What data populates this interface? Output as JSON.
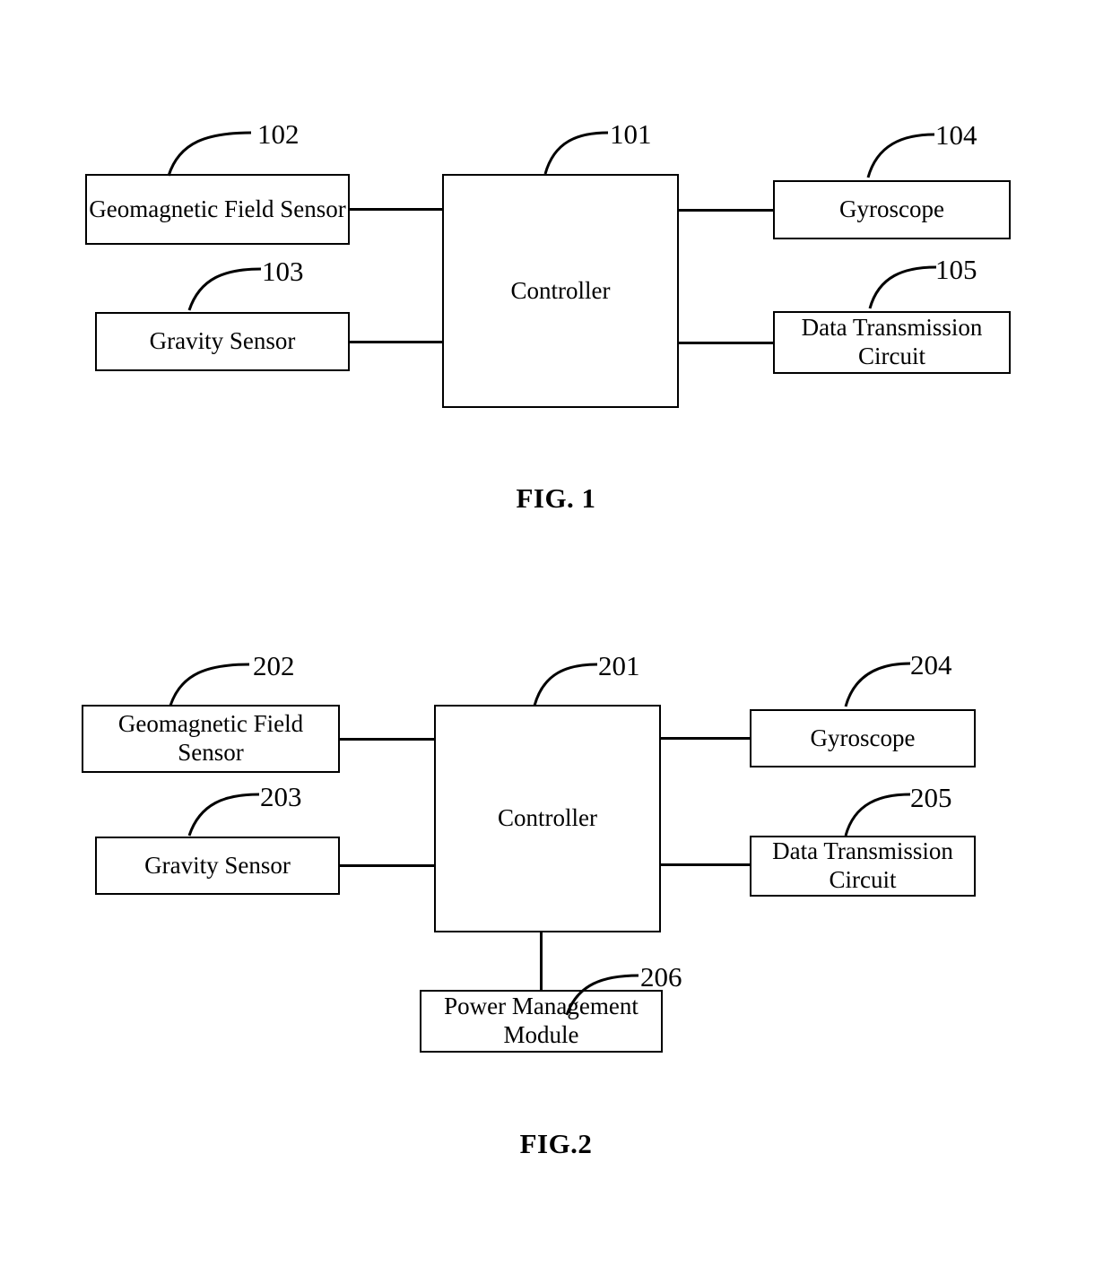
{
  "document": {
    "type": "patent-figure-sheet",
    "figures": [
      {
        "id": "fig1",
        "caption": "FIG. 1",
        "nodes": [
          {
            "key": "controller",
            "label": "Controller",
            "ref": "101"
          },
          {
            "key": "geomagnetic",
            "label": "Geomagnetic Field Sensor",
            "ref": "102"
          },
          {
            "key": "gravity",
            "label": "Gravity Sensor",
            "ref": "103"
          },
          {
            "key": "gyroscope",
            "label": "Gyroscope",
            "ref": "104"
          },
          {
            "key": "datatx",
            "label": "Data Transmission Circuit",
            "ref": "105"
          }
        ],
        "connections": [
          {
            "from": "geomagnetic",
            "to": "controller"
          },
          {
            "from": "gravity",
            "to": "controller"
          },
          {
            "from": "controller",
            "to": "gyroscope"
          },
          {
            "from": "controller",
            "to": "datatx"
          }
        ]
      },
      {
        "id": "fig2",
        "caption": "FIG.2",
        "nodes": [
          {
            "key": "controller",
            "label": "Controller",
            "ref": "201"
          },
          {
            "key": "geomagnetic",
            "label": "Geomagnetic Field Sensor",
            "ref": "202"
          },
          {
            "key": "gravity",
            "label": "Gravity Sensor",
            "ref": "203"
          },
          {
            "key": "gyroscope",
            "label": "Gyroscope",
            "ref": "204"
          },
          {
            "key": "datatx",
            "label": "Data Transmission Circuit",
            "ref": "205"
          },
          {
            "key": "power",
            "label": "Power Management Module",
            "ref": "206"
          }
        ],
        "connections": [
          {
            "from": "geomagnetic",
            "to": "controller"
          },
          {
            "from": "gravity",
            "to": "controller"
          },
          {
            "from": "controller",
            "to": "gyroscope"
          },
          {
            "from": "controller",
            "to": "datatx"
          },
          {
            "from": "controller",
            "to": "power"
          }
        ]
      }
    ]
  }
}
